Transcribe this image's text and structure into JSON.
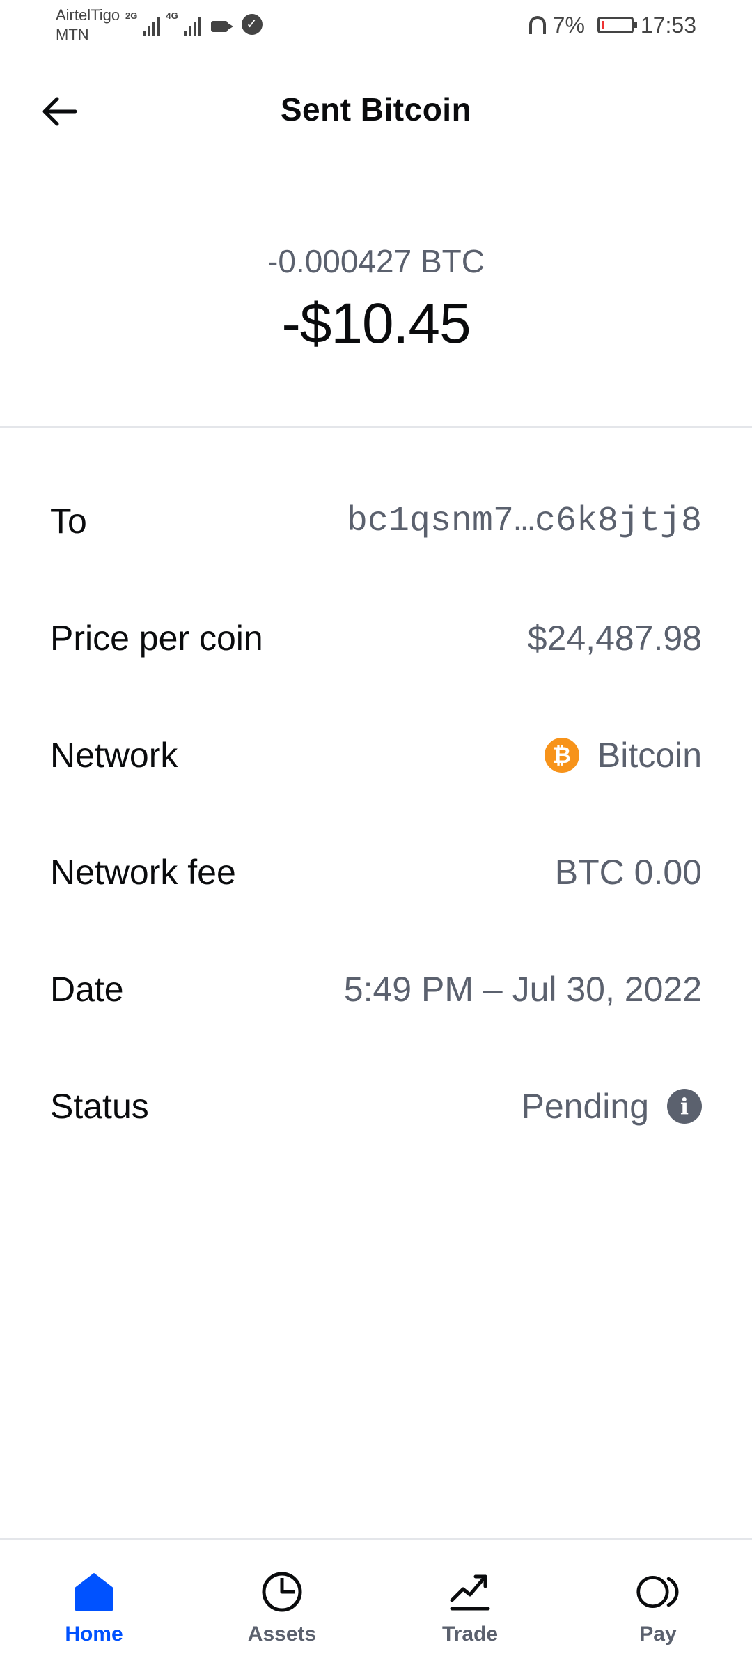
{
  "status_bar": {
    "carrier_1": "AirtelTigo",
    "carrier_2": "MTN",
    "net_1": "2G",
    "net_2": "4G",
    "battery_pct": "7%",
    "time": "17:53"
  },
  "header": {
    "title": "Sent Bitcoin"
  },
  "amount": {
    "crypto": "-0.000427 BTC",
    "fiat": "-$10.45"
  },
  "details": {
    "to": {
      "label": "To",
      "value": "bc1qsnm7…c6k8jtj8"
    },
    "price": {
      "label": "Price per coin",
      "value": "$24,487.98"
    },
    "network": {
      "label": "Network",
      "value": "Bitcoin",
      "icon": "bitcoin-icon",
      "icon_color": "#f7931a",
      "icon_glyph": "₿"
    },
    "fee": {
      "label": "Network fee",
      "value": "BTC 0.00"
    },
    "date": {
      "label": "Date",
      "value": "5:49 PM – Jul 30, 2022"
    },
    "status": {
      "label": "Status",
      "value": "Pending",
      "icon": "info-icon",
      "icon_glyph": "i"
    }
  },
  "nav": {
    "items": [
      {
        "label": "Home",
        "icon": "home-icon",
        "active": true
      },
      {
        "label": "Assets",
        "icon": "pie-chart-icon",
        "active": false
      },
      {
        "label": "Trade",
        "icon": "trend-chart-icon",
        "active": false
      },
      {
        "label": "Pay",
        "icon": "pay-icon",
        "active": false
      }
    ],
    "active_color": "#0052ff",
    "inactive_color": "#5b616e"
  }
}
